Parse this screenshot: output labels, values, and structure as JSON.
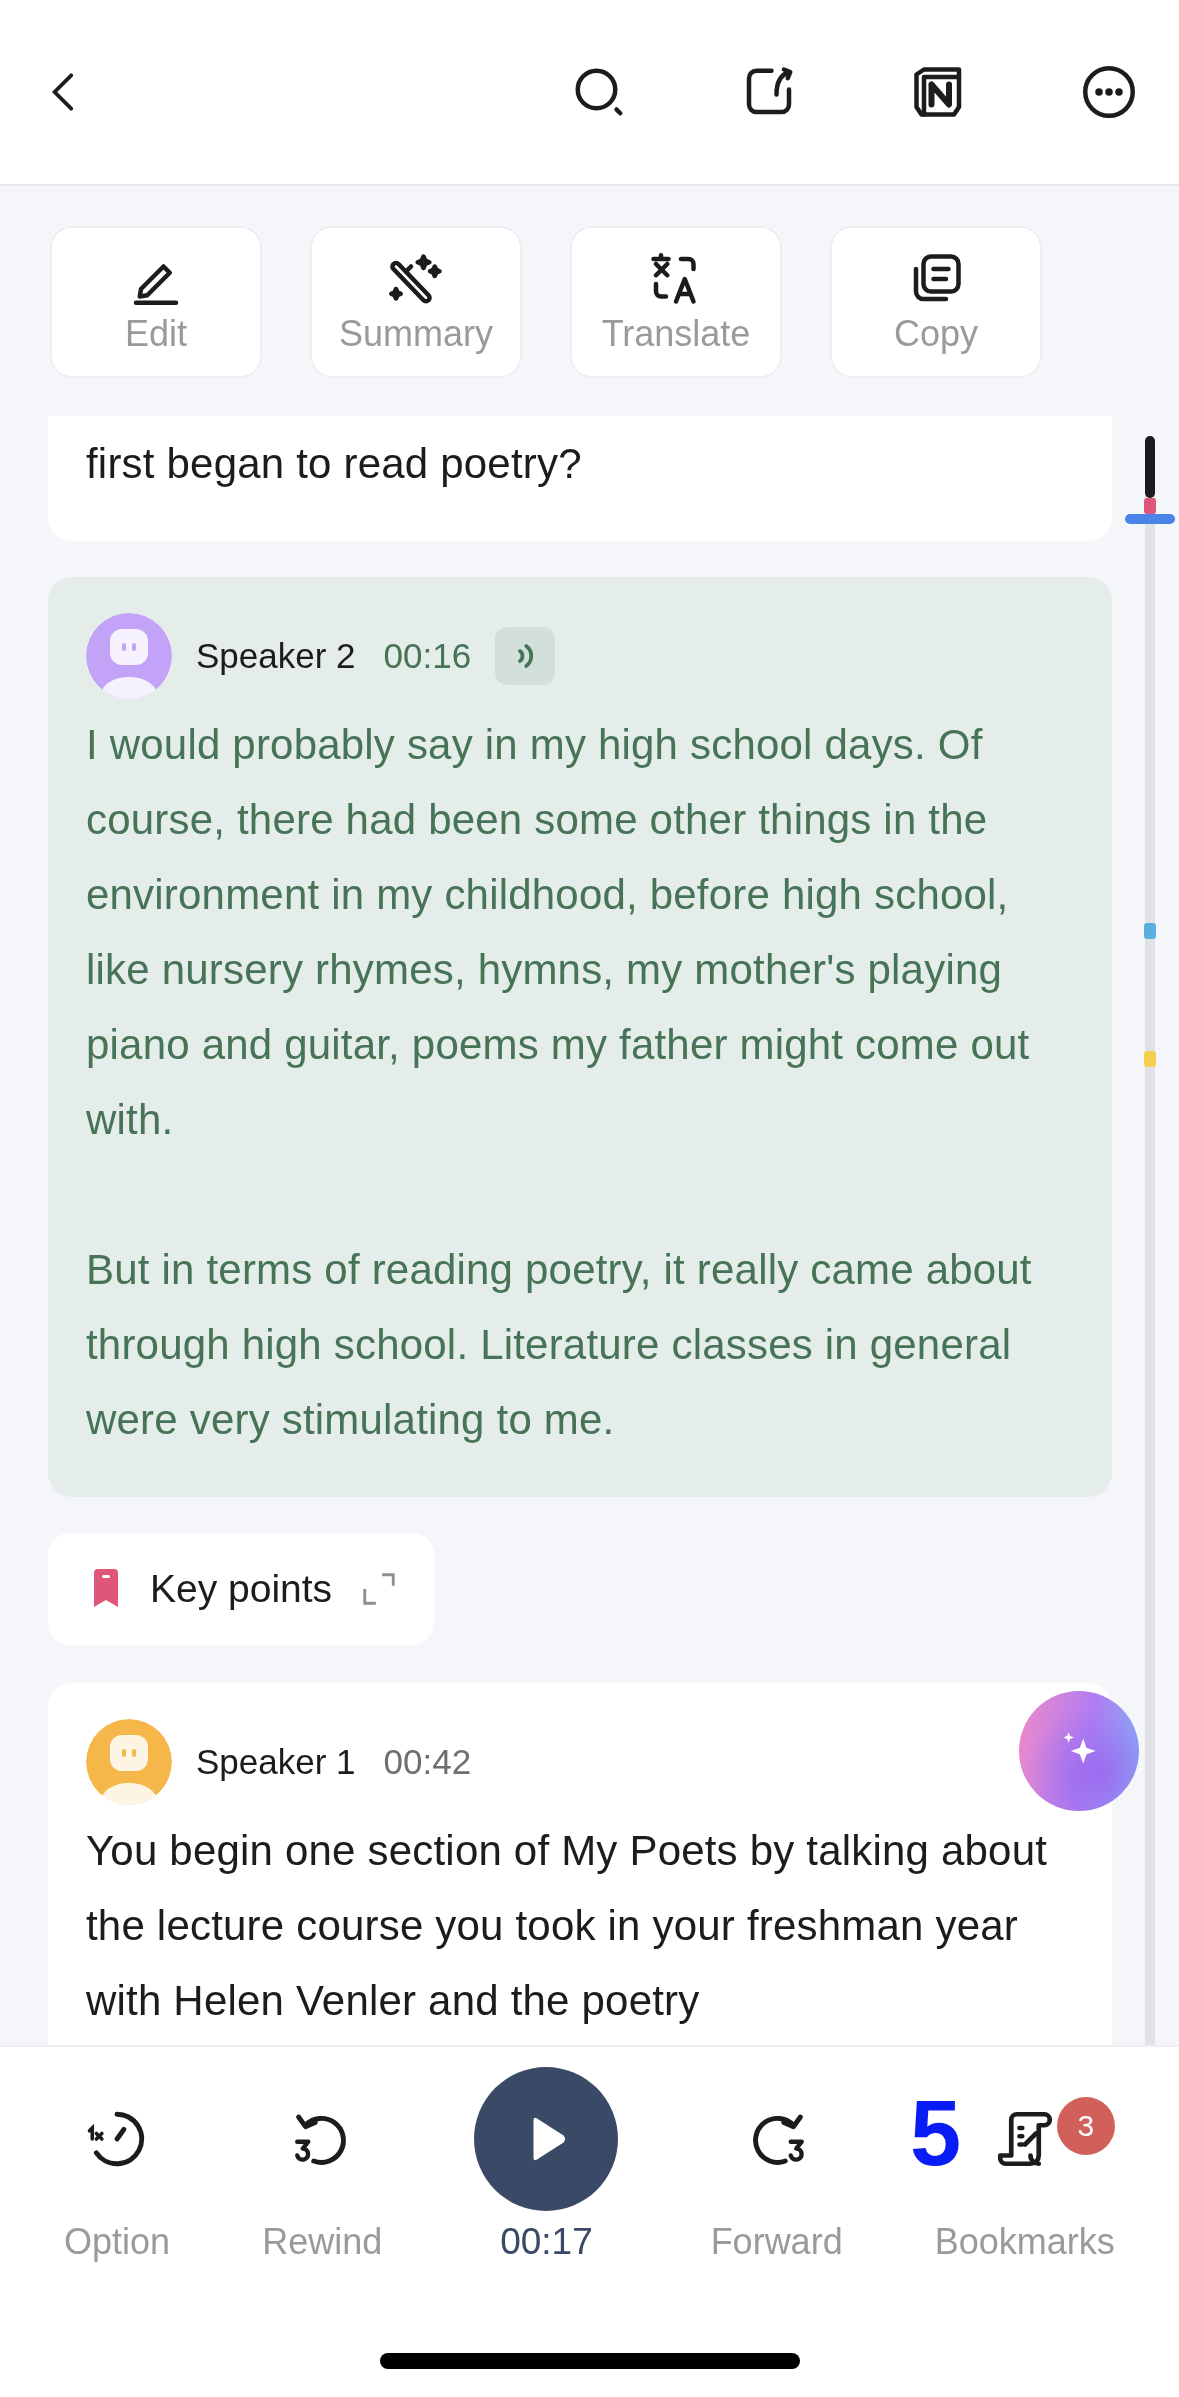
{
  "toolbar": [
    {
      "kind": "edit",
      "label": "Edit"
    },
    {
      "kind": "summary",
      "label": "Summary"
    },
    {
      "kind": "translate",
      "label": "Translate"
    },
    {
      "kind": "copy",
      "label": "Copy"
    }
  ],
  "transcript": [
    {
      "kind": "continued",
      "paragraphs": [
        "first began to read poetry?"
      ]
    },
    {
      "kind": "speaker",
      "speaker": "Speaker 2",
      "time": "00:16",
      "selected": true,
      "color": "#c3a3f7",
      "paragraphs": [
        "I would probably say in my high school days. Of course, there had been some other things in the environment in my childhood, before high school, like nursery rhymes, hymns, my mother's playing piano and guitar, poems my father might come out with.",
        "But in terms of reading poetry, it really came about through high school. Literature classes in general were very stimulating to me."
      ]
    },
    {
      "kind": "keypoints",
      "label": "Key points"
    },
    {
      "kind": "speaker",
      "speaker": "Speaker 1",
      "time": "00:42",
      "selected": false,
      "color": "#f5b74a",
      "paragraphs": [
        "You begin one section of My Poets by talking about the lecture course you took in your freshman year with Helen Venler and the poetry"
      ]
    }
  ],
  "scroll_markers": [
    {
      "color": "#e0557a"
    },
    {
      "color": "#5aaee0"
    },
    {
      "color": "#f5cf50"
    }
  ],
  "player": [
    {
      "kind": "option",
      "label": "Option"
    },
    {
      "kind": "rewind",
      "label": "Rewind"
    },
    {
      "kind": "play",
      "label": "00:17"
    },
    {
      "kind": "forward",
      "label": "Forward"
    },
    {
      "kind": "bookmarks",
      "label": "Bookmarks",
      "badge": "3"
    }
  ],
  "overlay_mark": "5"
}
